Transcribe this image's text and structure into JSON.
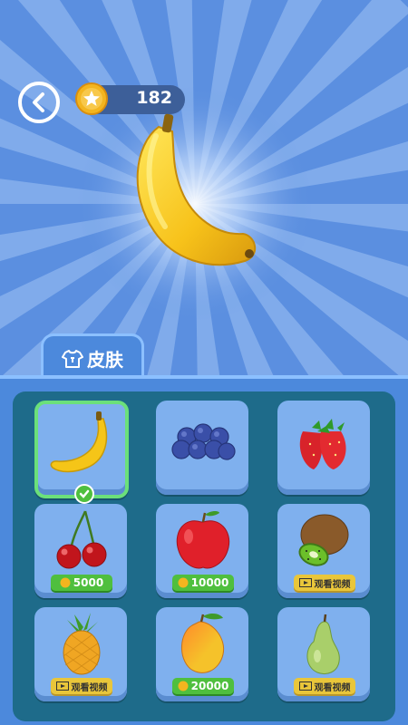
{
  "header": {
    "coins": "182"
  },
  "tab": {
    "label": "皮肤"
  },
  "items": [
    {
      "name": "banana",
      "price": "",
      "price_type": "owned"
    },
    {
      "name": "blueberry",
      "price": "",
      "price_type": "none"
    },
    {
      "name": "strawberry",
      "price": "",
      "price_type": "none"
    },
    {
      "name": "cherry",
      "price": "5000",
      "price_type": "coins"
    },
    {
      "name": "apple",
      "price": "10000",
      "price_type": "coins"
    },
    {
      "name": "kiwi",
      "price": "观看视频",
      "price_type": "video"
    },
    {
      "name": "pineapple",
      "price": "观看视频",
      "price_type": "video"
    },
    {
      "name": "mango",
      "price": "20000",
      "price_type": "coins"
    },
    {
      "name": "pear",
      "price": "观看视频",
      "price_type": "video"
    }
  ],
  "colors": {
    "background": "#5b8fe0",
    "panel": "#1e6b8a",
    "cell": "#7fb0ee",
    "selected": "#6be07a",
    "coin_button": "#4fbf3e",
    "video_button": "#e9c63a"
  },
  "icons": {
    "back": "chevron-left-icon",
    "coin": "star-coin-icon",
    "tab": "tshirt-icon",
    "video": "video-icon",
    "selected": "checkmark-icon"
  }
}
